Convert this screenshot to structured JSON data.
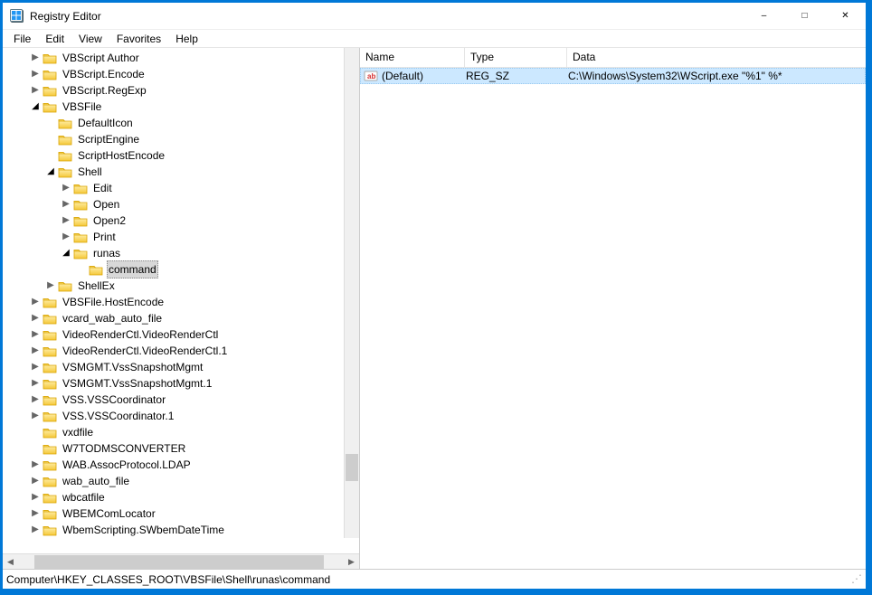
{
  "window": {
    "title": "Registry Editor"
  },
  "menu": {
    "file": "File",
    "edit": "Edit",
    "view": "View",
    "favorites": "Favorites",
    "help": "Help"
  },
  "tree": {
    "n0": "VBScript Author",
    "n1": "VBScript.Encode",
    "n2": "VBScript.RegExp",
    "n3": "VBSFile",
    "n3_0": "DefaultIcon",
    "n3_1": "ScriptEngine",
    "n3_2": "ScriptHostEncode",
    "n3_3": "Shell",
    "n3_3_0": "Edit",
    "n3_3_1": "Open",
    "n3_3_2": "Open2",
    "n3_3_3": "Print",
    "n3_3_4": "runas",
    "n3_3_4_0": "command",
    "n3_4": "ShellEx",
    "n4": "VBSFile.HostEncode",
    "n5": "vcard_wab_auto_file",
    "n6": "VideoRenderCtl.VideoRenderCtl",
    "n7": "VideoRenderCtl.VideoRenderCtl.1",
    "n8": "VSMGMT.VssSnapshotMgmt",
    "n9": "VSMGMT.VssSnapshotMgmt.1",
    "n10": "VSS.VSSCoordinator",
    "n11": "VSS.VSSCoordinator.1",
    "n12": "vxdfile",
    "n13": "W7TODMSCONVERTER",
    "n14": "WAB.AssocProtocol.LDAP",
    "n15": "wab_auto_file",
    "n16": "wbcatfile",
    "n17": "WBEMComLocator",
    "n18": "WbemScripting.SWbemDateTime"
  },
  "list": {
    "header_name": "Name",
    "header_type": "Type",
    "header_data": "Data",
    "rows": [
      {
        "name": "(Default)",
        "type": "REG_SZ",
        "data": "C:\\Windows\\System32\\WScript.exe \"%1\" %*"
      }
    ]
  },
  "statusbar": {
    "path": "Computer\\HKEY_CLASSES_ROOT\\VBSFile\\Shell\\runas\\command"
  }
}
